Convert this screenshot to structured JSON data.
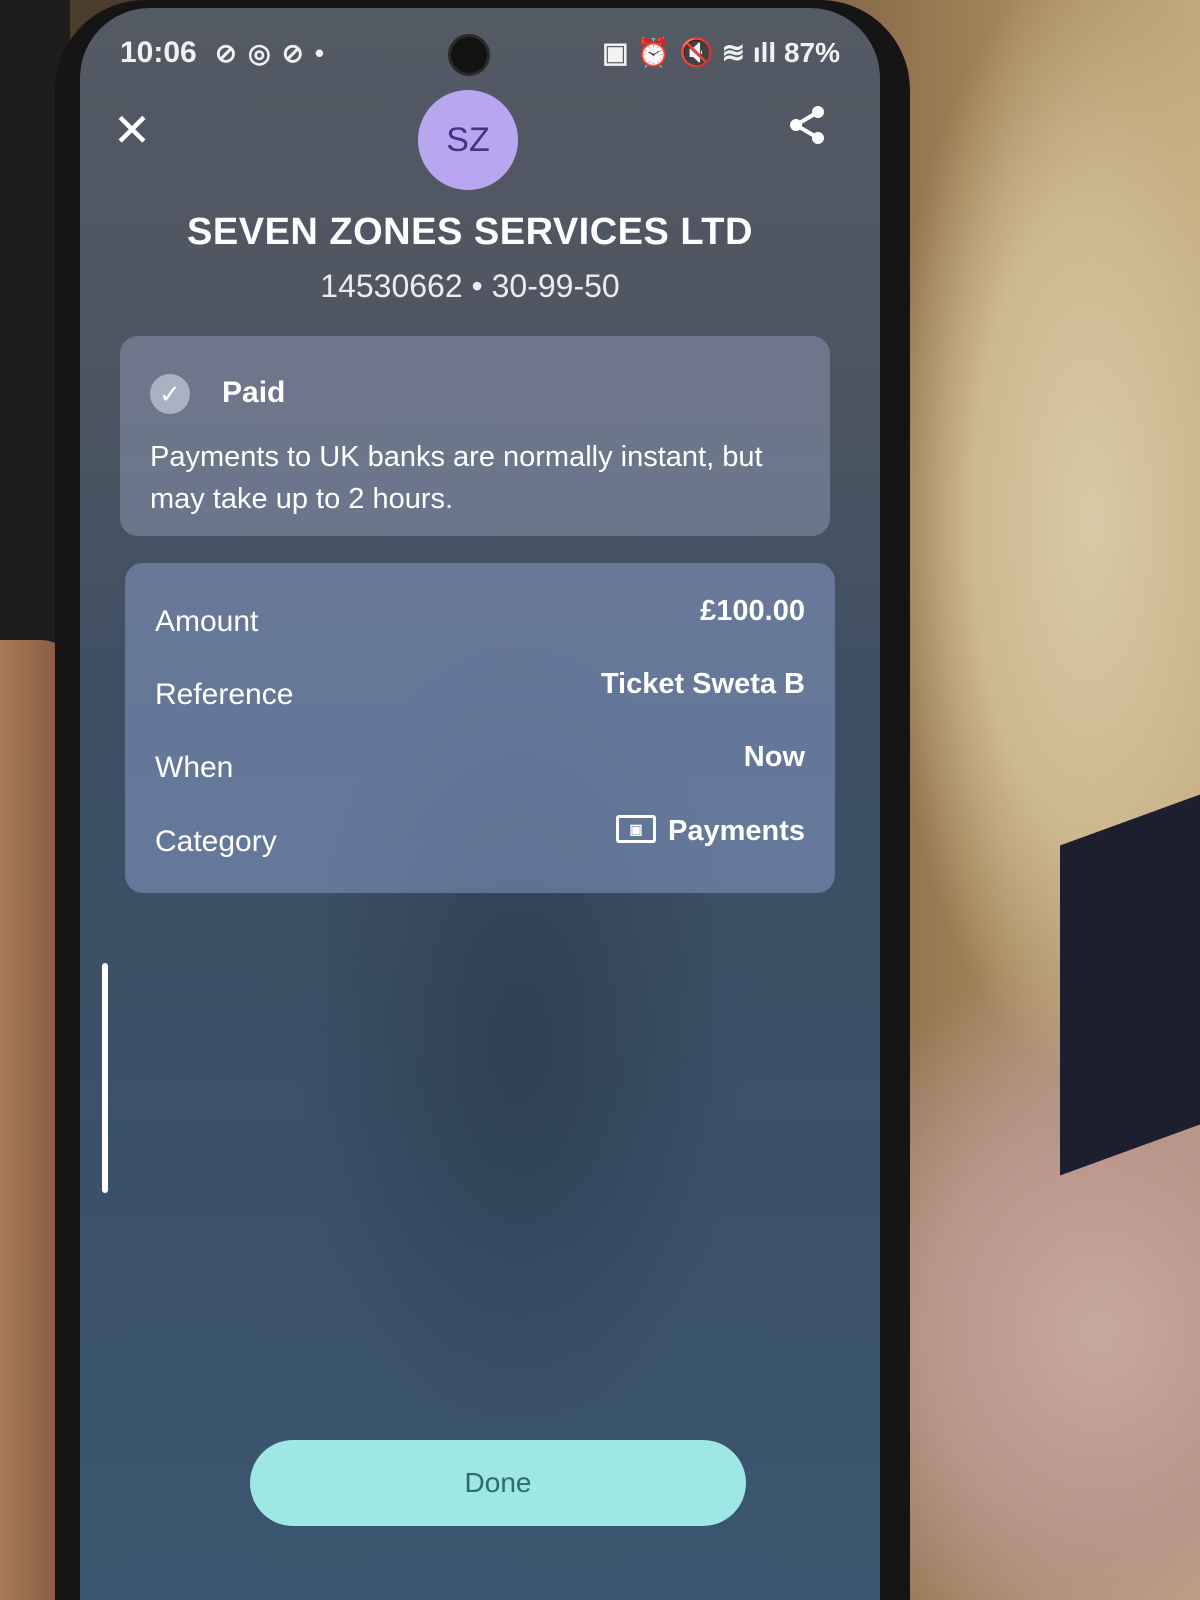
{
  "status_bar": {
    "time": "10:06",
    "notification_icons": "⊘ ◎ ⊘ •",
    "right_icons": "▣ ⏰ 🔇 ≋ ıll",
    "battery": "87%"
  },
  "header": {
    "close_glyph": "✕",
    "avatar_initials": "SZ",
    "share_icon": "share-icon"
  },
  "payee": {
    "name": "SEVEN ZONES SERVICES LTD",
    "account": "14530662 • 30-99-50"
  },
  "status_card": {
    "check_glyph": "✓",
    "title": "Paid",
    "description": "Payments to UK banks are normally instant, but may take up to 2 hours."
  },
  "details": [
    {
      "label": "Amount",
      "value": "£100.00"
    },
    {
      "label": "Reference",
      "value": "Ticket Sweta B"
    },
    {
      "label": "When",
      "value": "Now"
    },
    {
      "label": "Category",
      "value": "Payments",
      "icon": "cash-icon"
    }
  ],
  "footer": {
    "done_label": "Done"
  },
  "colors": {
    "avatar_bg": "#b9a6f0",
    "avatar_text": "#3e3587",
    "done_bg": "#9fe7e5",
    "done_text": "#2b6d6d"
  }
}
